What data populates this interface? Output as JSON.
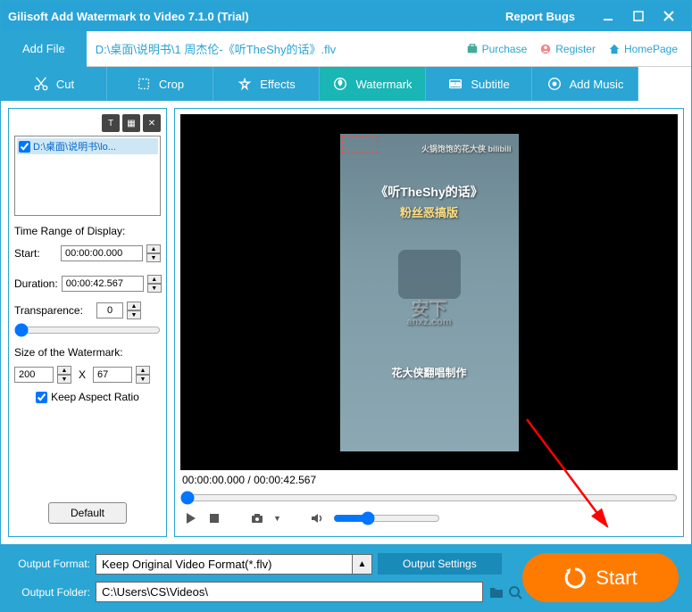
{
  "title": "Gilisoft Add Watermark to Video 7.1.0 (Trial)",
  "report_bugs": "Report Bugs",
  "add_file": "Add File",
  "file_path": "D:\\桌面\\说明书\\1 周杰伦-《听TheShy的话》.flv",
  "top_links": {
    "purchase": "Purchase",
    "register": "Register",
    "homepage": "HomePage"
  },
  "tabs": {
    "cut": "Cut",
    "crop": "Crop",
    "effects": "Effects",
    "watermark": "Watermark",
    "subtitle": "Subtitle",
    "add_music": "Add Music"
  },
  "left": {
    "file_item": "D:\\桌面\\说明书\\lo...",
    "time_range_label": "Time Range of Display:",
    "start_label": "Start:",
    "start_value": "00:00:00.000",
    "duration_label": "Duration:",
    "duration_value": "00:00:42.567",
    "transparence_label": "Transparence:",
    "transparence_value": "0",
    "size_label": "Size of the Watermark:",
    "width": "200",
    "x": "X",
    "height": "67",
    "keep_ratio": "Keep Aspect Ratio",
    "default": "Default"
  },
  "preview": {
    "v_top": "火锅饱饱的花大侠  bilibili",
    "v_title1": "《听TheShy的话》",
    "v_title2": "粉丝恶搞版",
    "v_wm": "安下",
    "v_wm2": "anxz.com",
    "v_bottom": "花大侠翻唱制作",
    "timecode": "00:00:00.000 / 00:00:42.567"
  },
  "bottom": {
    "format_label": "Output Format:",
    "format_value": "Keep Original Video Format(*.flv)",
    "settings": "Output Settings",
    "folder_label": "Output Folder:",
    "folder_value": "C:\\Users\\CS\\Videos\\",
    "start": "Start"
  }
}
